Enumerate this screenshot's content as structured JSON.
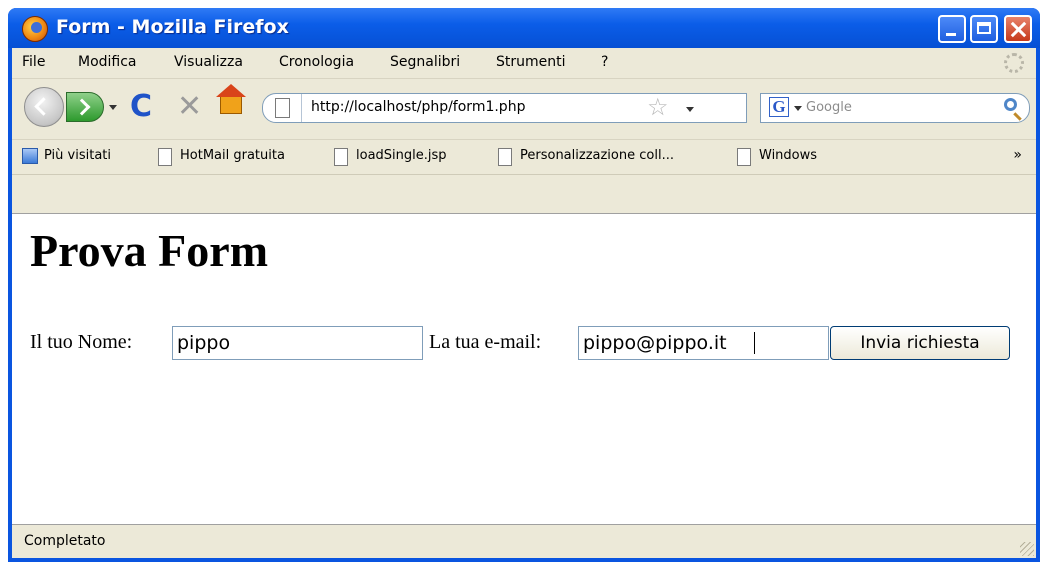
{
  "window": {
    "title": "Form - Mozilla Firefox"
  },
  "menu": [
    "File",
    "Modifica",
    "Visualizza",
    "Cronologia",
    "Segnalibri",
    "Strumenti",
    "?"
  ],
  "toolbar": {
    "url": "http://localhost/php/form1.php",
    "search_placeholder": "Google",
    "search_engine_letter": "G"
  },
  "bookmarks": {
    "items": [
      "Più visitati",
      "HotMail gratuita",
      "loadSingle.jsp",
      "Personalizzazione coll...",
      "Windows"
    ],
    "overflow": "»"
  },
  "page": {
    "heading": "Prova Form",
    "name_label": "Il tuo Nome:",
    "name_value": "pippo",
    "email_label": "La tua e-mail:",
    "email_value": "pippo@pippo.it",
    "submit_label": "Invia richiesta"
  },
  "status": {
    "text": "Completato"
  },
  "colors": {
    "titlebar": "#0b5de8",
    "chrome": "#ece9d8",
    "field_border": "#7f9db9"
  }
}
